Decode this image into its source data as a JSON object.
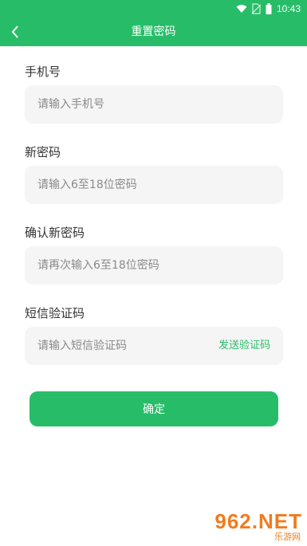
{
  "status_bar": {
    "time": "10:43",
    "icons": [
      "wifi-icon",
      "no-sim-icon",
      "battery-icon"
    ]
  },
  "header": {
    "title": "重置密码",
    "back_icon": "chevron-left-icon"
  },
  "form": {
    "phone": {
      "label": "手机号",
      "placeholder": "请输入手机号"
    },
    "new_password": {
      "label": "新密码",
      "placeholder": "请输入6至18位密码"
    },
    "confirm_password": {
      "label": "确认新密码",
      "placeholder": "请再次输入6至18位密码"
    },
    "sms_code": {
      "label": "短信验证码",
      "placeholder": "请输入短信验证码",
      "send_label": "发送验证码"
    },
    "submit_label": "确定"
  },
  "watermark": {
    "main": "962.NET",
    "sub": "乐游网"
  },
  "colors": {
    "accent": "#27bd68",
    "field_bg": "#f5f5f5",
    "watermark": "#f07c1e"
  }
}
